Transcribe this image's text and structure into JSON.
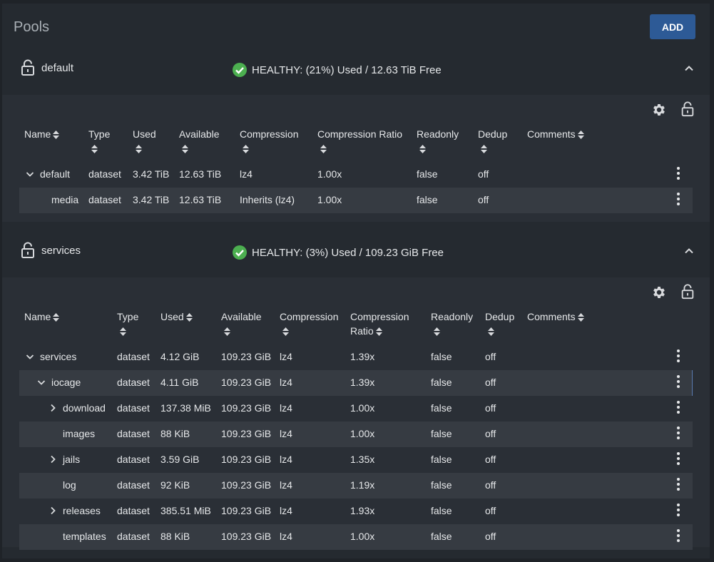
{
  "page": {
    "title": "Pools",
    "add_label": "ADD"
  },
  "pools": [
    {
      "name": "default",
      "status": "HEALTHY: (21%) Used / 12.63 TiB Free",
      "headers": [
        "Name",
        "Type",
        "Used",
        "Available",
        "Compression",
        "Compression Ratio",
        "Readonly",
        "Dedup",
        "Comments"
      ],
      "rows": [
        {
          "name": "default",
          "type": "dataset",
          "used": "3.42 TiB",
          "available": "12.63 TiB",
          "compression": "lz4",
          "ratio": "1.00x",
          "readonly": "false",
          "dedup": "off"
        },
        {
          "name": "media",
          "type": "dataset",
          "used": "3.42 TiB",
          "available": "12.63 TiB",
          "compression": "Inherits (lz4)",
          "ratio": "1.00x",
          "readonly": "false",
          "dedup": "off"
        }
      ]
    },
    {
      "name": "services",
      "status": "HEALTHY: (3%) Used / 109.23 GiB Free",
      "headers": [
        "Name",
        "Type",
        "Used",
        "Available",
        "Compression",
        "Compression",
        "Ratio",
        "Readonly",
        "Dedup",
        "Comments"
      ],
      "rows": [
        {
          "name": "services",
          "type": "dataset",
          "used": "4.12 GiB",
          "available": "109.23 GiB",
          "compression": "lz4",
          "ratio": "1.39x",
          "readonly": "false",
          "dedup": "off"
        },
        {
          "name": "iocage",
          "type": "dataset",
          "used": "4.11 GiB",
          "available": "109.23 GiB",
          "compression": "lz4",
          "ratio": "1.39x",
          "readonly": "false",
          "dedup": "off"
        },
        {
          "name": "download",
          "type": "dataset",
          "used": "137.38 MiB",
          "available": "109.23 GiB",
          "compression": "lz4",
          "ratio": "1.00x",
          "readonly": "false",
          "dedup": "off"
        },
        {
          "name": "images",
          "type": "dataset",
          "used": "88 KiB",
          "available": "109.23 GiB",
          "compression": "lz4",
          "ratio": "1.00x",
          "readonly": "false",
          "dedup": "off"
        },
        {
          "name": "jails",
          "type": "dataset",
          "used": "3.59 GiB",
          "available": "109.23 GiB",
          "compression": "lz4",
          "ratio": "1.35x",
          "readonly": "false",
          "dedup": "off"
        },
        {
          "name": "log",
          "type": "dataset",
          "used": "92 KiB",
          "available": "109.23 GiB",
          "compression": "lz4",
          "ratio": "1.19x",
          "readonly": "false",
          "dedup": "off"
        },
        {
          "name": "releases",
          "type": "dataset",
          "used": "385.51 MiB",
          "available": "109.23 GiB",
          "compression": "lz4",
          "ratio": "1.93x",
          "readonly": "false",
          "dedup": "off"
        },
        {
          "name": "templates",
          "type": "dataset",
          "used": "88 KiB",
          "available": "109.23 GiB",
          "compression": "lz4",
          "ratio": "1.00x",
          "readonly": "false",
          "dedup": "off"
        }
      ]
    }
  ],
  "icons": {
    "lock": "lock-open-icon",
    "check": "check-circle-icon",
    "gear": "gear-icon",
    "chevron": "chevron-up-icon",
    "menu": "more-vert-icon"
  },
  "colors": {
    "accent": "#2d5a96",
    "healthy": "#4caf50",
    "background": "#252a30",
    "row_alt": "#363b42"
  }
}
